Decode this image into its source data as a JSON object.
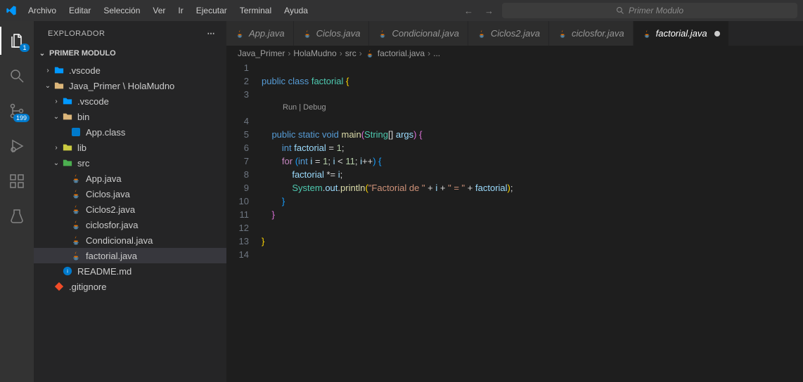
{
  "menu": [
    "Archivo",
    "Editar",
    "Selección",
    "Ver",
    "Ir",
    "Ejecutar",
    "Terminal",
    "Ayuda"
  ],
  "search_placeholder": "Primer Modulo",
  "activity_badges": {
    "files": "1",
    "scm": "199"
  },
  "sidebar_title": "EXPLORADOR",
  "section_title": "PRIMER MODULO",
  "tree": [
    {
      "depth": 0,
      "chev": ">",
      "icon": "folder-vs",
      "label": ".vscode"
    },
    {
      "depth": 0,
      "chev": "v",
      "icon": "folder-open",
      "label": "Java_Primer \\ HolaMudno"
    },
    {
      "depth": 1,
      "chev": ">",
      "icon": "folder-vs",
      "label": ".vscode"
    },
    {
      "depth": 1,
      "chev": "v",
      "icon": "folder-open",
      "label": "bin"
    },
    {
      "depth": 2,
      "chev": "",
      "icon": "class",
      "label": "App.class"
    },
    {
      "depth": 1,
      "chev": ">",
      "icon": "folder-yellow",
      "label": "lib"
    },
    {
      "depth": 1,
      "chev": "v",
      "icon": "folder-src",
      "label": "src"
    },
    {
      "depth": 2,
      "chev": "",
      "icon": "java",
      "label": "App.java"
    },
    {
      "depth": 2,
      "chev": "",
      "icon": "java",
      "label": "Ciclos.java"
    },
    {
      "depth": 2,
      "chev": "",
      "icon": "java",
      "label": "Ciclos2.java"
    },
    {
      "depth": 2,
      "chev": "",
      "icon": "java",
      "label": "ciclosfor.java"
    },
    {
      "depth": 2,
      "chev": "",
      "icon": "java",
      "label": "Condicional.java"
    },
    {
      "depth": 2,
      "chev": "",
      "icon": "java",
      "label": "factorial.java",
      "selected": true
    },
    {
      "depth": 1,
      "chev": "",
      "icon": "md",
      "label": "README.md"
    },
    {
      "depth": 0,
      "chev": "",
      "icon": "git",
      "label": ".gitignore"
    }
  ],
  "tabs": [
    {
      "label": "App.java",
      "active": false
    },
    {
      "label": "Ciclos.java",
      "active": false
    },
    {
      "label": "Condicional.java",
      "active": false
    },
    {
      "label": "Ciclos2.java",
      "active": false
    },
    {
      "label": "ciclosfor.java",
      "active": false
    },
    {
      "label": "factorial.java",
      "active": true,
      "dirty": true
    }
  ],
  "breadcrumb": [
    "Java_Primer",
    "HolaMudno",
    "src",
    "factorial.java",
    "..."
  ],
  "codelens": "Run | Debug",
  "line_numbers": [
    "1",
    "2",
    "3",
    "4",
    "5",
    "6",
    "7",
    "8",
    "9",
    "10",
    "11",
    "12",
    "13",
    "14"
  ],
  "code": {
    "l1": {
      "a": "public",
      "b": "class",
      "c": "factorial",
      "d": "{"
    },
    "l4": {
      "a": "public",
      "b": "static",
      "c": "void",
      "d": "main",
      "e": "(",
      "f": "String",
      "g": "[]",
      "h": "args",
      "i": ")",
      "j": "{"
    },
    "l5": {
      "a": "int",
      "b": "factorial",
      "c": "=",
      "d": "1",
      "e": ";"
    },
    "l6": {
      "a": "for",
      "b": "(",
      "c": "int",
      "d": "i",
      "e": "=",
      "f": "1",
      "g": ";",
      "h": "i",
      "i": "<",
      "j": "11",
      "k": ";",
      "l": "i",
      "m": "++",
      "n": ")",
      "o": "{"
    },
    "l7": {
      "a": "factorial",
      "b": "*=",
      "c": "i",
      "d": ";"
    },
    "l8": {
      "a": "System",
      "b": ".",
      "c": "out",
      "d": ".",
      "e": "println",
      "f": "(",
      "g": "\"Factorial de \"",
      "h": "+",
      "i": "i",
      "j": "+",
      "k": "\" = \"",
      "l": "+",
      "m": "factorial",
      "n": ")",
      "o": ";"
    },
    "l9": {
      "a": "}"
    },
    "l10": {
      "a": "}"
    },
    "l12": {
      "a": "}"
    }
  }
}
